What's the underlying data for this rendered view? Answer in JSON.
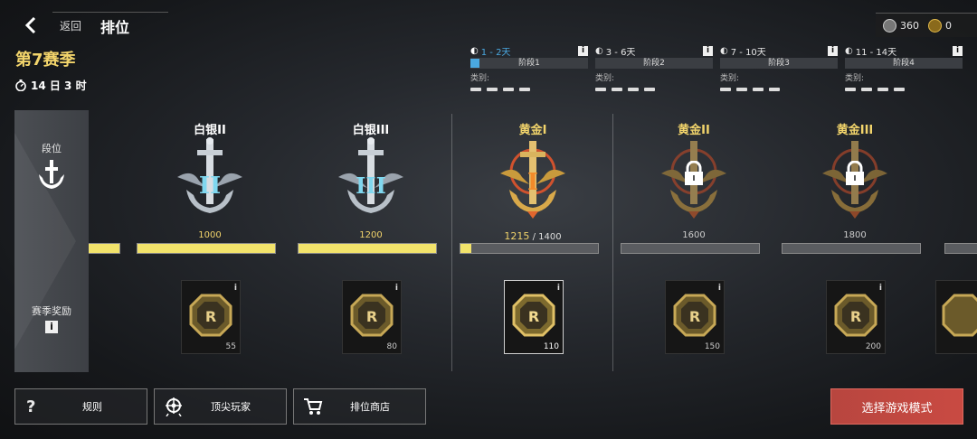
{
  "header": {
    "back_label": "返回",
    "title": "排位"
  },
  "season": {
    "name": "第7赛季",
    "time_left": "14 日 3 时"
  },
  "currency": [
    {
      "icon": "silver-coin-icon",
      "value": "360",
      "color": "#c9c9c9"
    },
    {
      "icon": "gold-coin-icon",
      "value": "0",
      "color": "#d9b44a"
    }
  ],
  "stages": [
    {
      "days": "1 - 2天",
      "name": "阶段1",
      "category_label": "类别:",
      "active": true
    },
    {
      "days": "3 - 6天",
      "name": "阶段2",
      "category_label": "类别:",
      "active": false
    },
    {
      "days": "7 - 10天",
      "name": "阶段3",
      "category_label": "类别:",
      "active": false
    },
    {
      "days": "11 - 14天",
      "name": "阶段4",
      "category_label": "类别:",
      "active": false
    }
  ],
  "left_panel": {
    "rank_label": "段位",
    "reward_label": "赛季奖励"
  },
  "ranks": [
    {
      "name": "白银II",
      "points": "1000",
      "progress": 1.0,
      "tier": "silver",
      "locked": false,
      "reward_qty": "55",
      "numeral": "II"
    },
    {
      "name": "白银III",
      "points": "1200",
      "progress": 1.0,
      "tier": "silver",
      "locked": false,
      "reward_qty": "80",
      "numeral": "III"
    },
    {
      "name": "黄金I",
      "points": "1215",
      "points_target": "/ 1400",
      "progress": 0.08,
      "tier": "gold",
      "locked": false,
      "reward_qty": "110",
      "numeral": "I"
    },
    {
      "name": "黄金II",
      "points": "1600",
      "progress": 0.0,
      "tier": "gold",
      "locked": true,
      "reward_qty": "150"
    },
    {
      "name": "黄金III",
      "points": "1800",
      "progress": 0.0,
      "tier": "gold",
      "locked": true,
      "reward_qty": "200"
    }
  ],
  "buttons": {
    "rules": "规则",
    "top_players": "顶尖玩家",
    "rank_shop": "排位商店",
    "select_mode": "选择游戏模式"
  },
  "colors": {
    "gold": "#f2d46b",
    "progress_fill": "#f2e36b",
    "cta": "#c94a42",
    "stage_active": "#4aa8e0"
  }
}
